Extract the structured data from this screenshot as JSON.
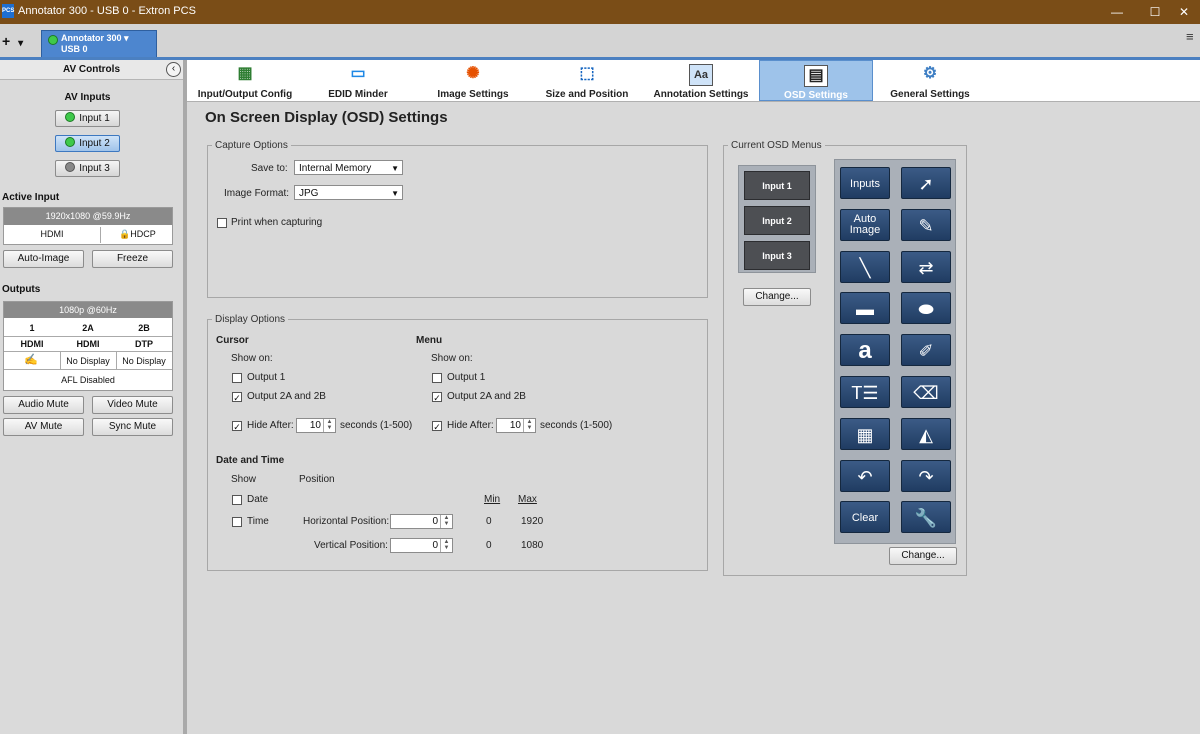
{
  "window": {
    "title": "Annotator 300 - USB 0 - Extron PCS",
    "logo": "PCS",
    "minimize": "—",
    "maximize": "☐",
    "close": "✕"
  },
  "devicebar": {
    "add": "+",
    "dropdown": "▾",
    "device_name": "Annotator 300 ▾",
    "device_port": "USB 0",
    "menu": "≡"
  },
  "left": {
    "header": "AV Controls",
    "collapse": "‹",
    "av_inputs_label": "AV Inputs",
    "inputs": [
      "Input 1",
      "Input 2",
      "Input 3"
    ],
    "active_input_label": "Active Input",
    "active_res": "1920x1080 @59.9Hz",
    "active_type": "HDMI",
    "active_hdcp": "HDCP",
    "auto_image": "Auto-Image",
    "freeze": "Freeze",
    "outputs_label": "Outputs",
    "output_res": "1080p @60Hz",
    "output_cols": [
      "1",
      "2A",
      "2B"
    ],
    "output_types": [
      "HDMI",
      "HDMI",
      "DTP"
    ],
    "output_status": [
      "",
      "No Display",
      "No Display"
    ],
    "afl": "AFL Disabled",
    "audio_mute": "Audio Mute",
    "video_mute": "Video Mute",
    "av_mute": "AV Mute",
    "sync_mute": "Sync Mute"
  },
  "tabs": [
    {
      "label": "Input/Output Config",
      "icon": "▦"
    },
    {
      "label": "EDID Minder",
      "icon": "▭"
    },
    {
      "label": "Image Settings",
      "icon": "✺"
    },
    {
      "label": "Size and Position",
      "icon": "⬚"
    },
    {
      "label": "Annotation Settings",
      "icon": "Aa"
    },
    {
      "label": "OSD Settings",
      "icon": "▤"
    },
    {
      "label": "General Settings",
      "icon": "⚙"
    }
  ],
  "page_title": "On Screen Display (OSD) Settings",
  "capture": {
    "legend": "Capture Options",
    "save_to_label": "Save to:",
    "save_to_value": "Internal Memory",
    "format_label": "Image Format:",
    "format_value": "JPG",
    "print_label": "Print when capturing"
  },
  "display": {
    "legend": "Display Options",
    "cursor_label": "Cursor",
    "menu_label": "Menu",
    "show_on": "Show on:",
    "output1": "Output 1",
    "output2": "Output 2A and 2B",
    "hide_after": "Hide After:",
    "hide_value": "10",
    "seconds": "seconds (1-500)",
    "check": "✓",
    "date_time_label": "Date and Time",
    "show": "Show",
    "position": "Position",
    "min": "Min",
    "max": "Max",
    "date": "Date",
    "time": "Time",
    "hpos_label": "Horizontal Position:",
    "vpos_label": "Vertical Position:",
    "hpos_value": "0",
    "vpos_value": "0",
    "hmin": "0",
    "hmax": "1920",
    "vmin": "0",
    "vmax": "1080"
  },
  "osd": {
    "legend": "Current OSD Menus",
    "inputs": [
      "Input 1",
      "Input 2",
      "Input 3"
    ],
    "change": "Change...",
    "change2": "Change...",
    "tools": [
      {
        "name": "inputs-tool",
        "label": "Inputs"
      },
      {
        "name": "pointer-tool",
        "label": "➚"
      },
      {
        "name": "auto-image-tool",
        "label": "Auto Image"
      },
      {
        "name": "freehand-tool",
        "label": "✎"
      },
      {
        "name": "line-tool",
        "label": "╲"
      },
      {
        "name": "arrow-swap-tool",
        "label": "⇄"
      },
      {
        "name": "rectangle-tool",
        "label": "▬"
      },
      {
        "name": "ellipse-tool",
        "label": "⬬"
      },
      {
        "name": "text-tool",
        "label": "a"
      },
      {
        "name": "highlighter-tool",
        "label": "✐"
      },
      {
        "name": "text-size-tool",
        "label": "T☰"
      },
      {
        "name": "eraser-tool",
        "label": "⌫"
      },
      {
        "name": "color-palette-tool",
        "label": "▦"
      },
      {
        "name": "spotlight-tool",
        "label": "◭"
      },
      {
        "name": "undo-tool",
        "label": "↶"
      },
      {
        "name": "redo-tool",
        "label": "↷"
      },
      {
        "name": "clear-tool",
        "label": "Clear"
      },
      {
        "name": "settings-tool",
        "label": "🔧"
      }
    ]
  }
}
